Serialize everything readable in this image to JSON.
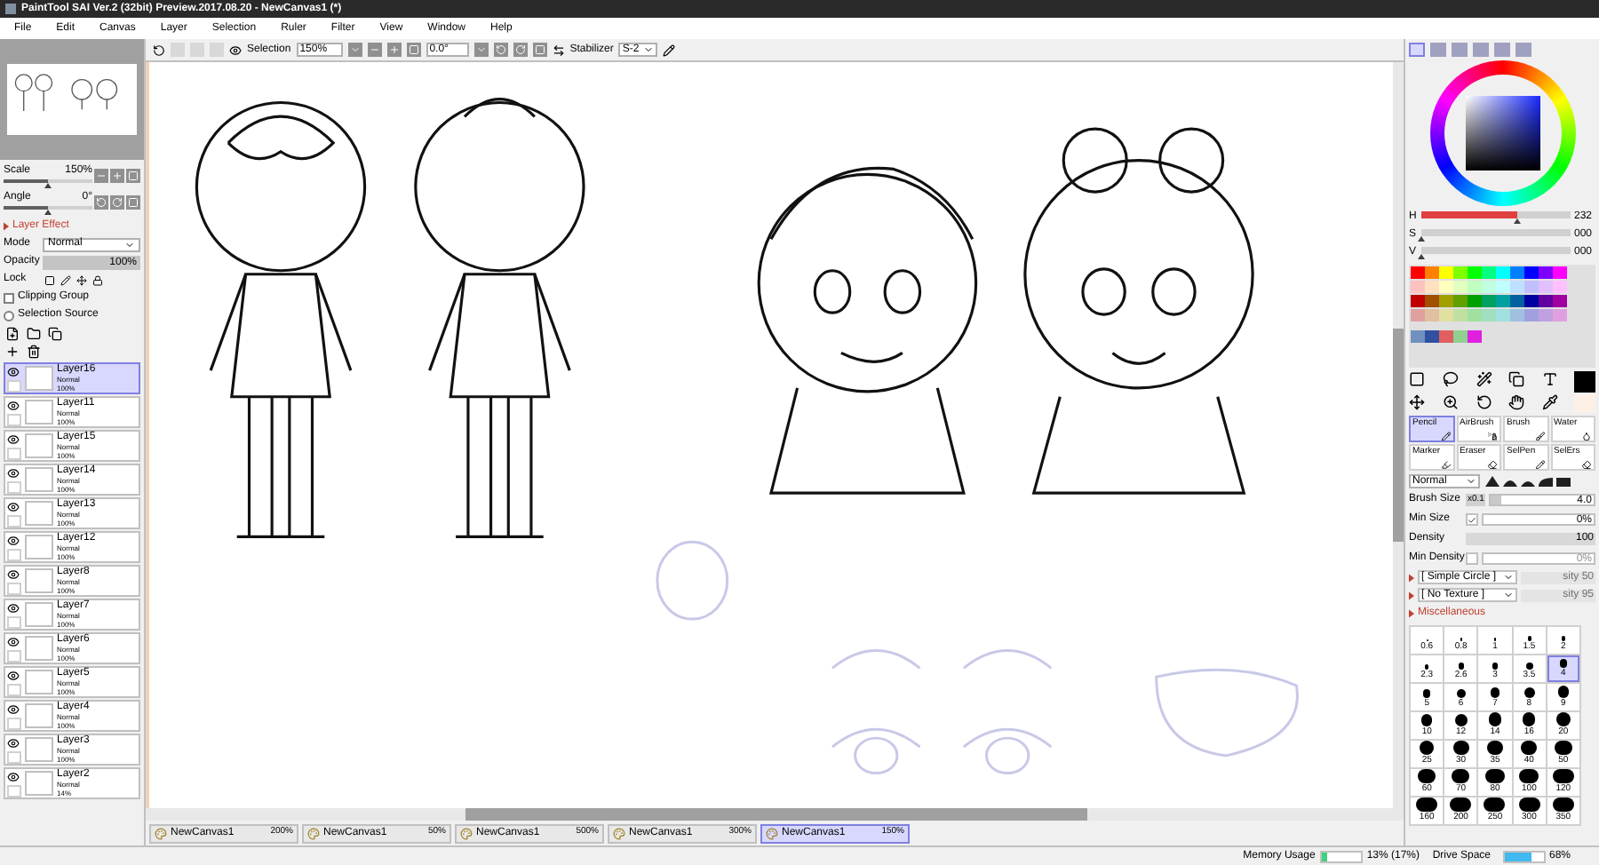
{
  "window": {
    "title": "PaintTool SAI Ver.2 (32bit) Preview.2017.08.20 - NewCanvas1 (*)"
  },
  "menu": [
    "File",
    "Edit",
    "Canvas",
    "Layer",
    "Selection",
    "Ruler",
    "Filter",
    "View",
    "Window",
    "Help"
  ],
  "navigator": {
    "sliders": [
      {
        "label": "Scale",
        "value": "150%",
        "level": 0.5
      },
      {
        "label": "Angle",
        "value": "0°",
        "level": 0.5
      }
    ]
  },
  "layer_panel": {
    "section": "Layer Effect",
    "mode_label": "Mode",
    "mode": "Normal",
    "opacity_label": "Opacity",
    "opacity": {
      "value": "100%",
      "level": 1
    },
    "lock_label": "Lock",
    "options": [
      {
        "label": "Clipping Group",
        "checked": false,
        "kind": "checkbox"
      },
      {
        "label": "Selection Source",
        "checked": false,
        "kind": "radio"
      }
    ]
  },
  "layers": [
    {
      "name": "Layer16",
      "mode": "Normal",
      "opacity": "100%",
      "selected": true,
      "visible": true
    },
    {
      "name": "Layer11",
      "mode": "Normal",
      "opacity": "100%",
      "selected": false,
      "visible": true
    },
    {
      "name": "Layer15",
      "mode": "Normal",
      "opacity": "100%",
      "selected": false,
      "visible": true
    },
    {
      "name": "Layer14",
      "mode": "Normal",
      "opacity": "100%",
      "selected": false,
      "visible": true
    },
    {
      "name": "Layer13",
      "mode": "Normal",
      "opacity": "100%",
      "selected": false,
      "visible": true
    },
    {
      "name": "Layer12",
      "mode": "Normal",
      "opacity": "100%",
      "selected": false,
      "visible": true
    },
    {
      "name": "Layer8",
      "mode": "Normal",
      "opacity": "100%",
      "selected": false,
      "visible": true
    },
    {
      "name": "Layer7",
      "mode": "Normal",
      "opacity": "100%",
      "selected": false,
      "visible": true
    },
    {
      "name": "Layer6",
      "mode": "Normal",
      "opacity": "100%",
      "selected": false,
      "visible": true
    },
    {
      "name": "Layer5",
      "mode": "Normal",
      "opacity": "100%",
      "selected": false,
      "visible": true
    },
    {
      "name": "Layer4",
      "mode": "Normal",
      "opacity": "100%",
      "selected": false,
      "visible": true
    },
    {
      "name": "Layer3",
      "mode": "Normal",
      "opacity": "100%",
      "selected": false,
      "visible": true
    },
    {
      "name": "Layer2",
      "mode": "Normal",
      "opacity": "14%",
      "selected": false,
      "visible": true
    }
  ],
  "toolbar": {
    "selection_label": "Selection",
    "selection_visible": true,
    "zoom": "150%",
    "angle": "0.0°",
    "stabilizer_label": "Stabilizer",
    "stabilizer": "S-2"
  },
  "canvas_tabs": [
    {
      "name": "NewCanvas1",
      "zoom": "200%",
      "selected": false
    },
    {
      "name": "NewCanvas1",
      "zoom": "50%",
      "selected": false
    },
    {
      "name": "NewCanvas1",
      "zoom": "500%",
      "selected": false
    },
    {
      "name": "NewCanvas1",
      "zoom": "300%",
      "selected": false
    },
    {
      "name": "NewCanvas1",
      "zoom": "150%",
      "selected": true
    }
  ],
  "status": {
    "memory": {
      "label": "Memory Usage",
      "value": "13% (17%)",
      "level": 0.13
    },
    "drive": {
      "label": "Drive Space",
      "value": "68%",
      "level": 0.68
    }
  },
  "color": {
    "hsv": [
      {
        "label": "H",
        "value": "232",
        "level": 0.64
      },
      {
        "label": "S",
        "value": "000",
        "level": 0
      },
      {
        "label": "V",
        "value": "000",
        "level": 0
      }
    ],
    "palette": [
      [
        {
          "color": "#ff0000"
        },
        {
          "color": "#ff8000"
        },
        {
          "color": "#ffff00"
        },
        {
          "color": "#80ff00"
        },
        {
          "color": "#00ff00"
        },
        {
          "color": "#00ff80"
        },
        {
          "color": "#00ffff"
        },
        {
          "color": "#0080ff"
        },
        {
          "color": "#0000ff"
        },
        {
          "color": "#8000ff"
        },
        {
          "color": "#ff00ff"
        }
      ],
      [
        {
          "color": "#ffc0c0"
        },
        {
          "color": "#ffe0c0"
        },
        {
          "color": "#ffffc0"
        },
        {
          "color": "#e0ffc0"
        },
        {
          "color": "#c0ffc0"
        },
        {
          "color": "#c0ffe0"
        },
        {
          "color": "#c0ffff"
        },
        {
          "color": "#c0e0ff"
        },
        {
          "color": "#c0c0ff"
        },
        {
          "color": "#e0c0ff"
        },
        {
          "color": "#ffc0ff"
        }
      ],
      [
        {
          "color": "#c00000"
        },
        {
          "color": "#a05000"
        },
        {
          "color": "#a0a000"
        },
        {
          "color": "#60a000"
        },
        {
          "color": "#00a000"
        },
        {
          "color": "#00a060"
        },
        {
          "color": "#00a0a0"
        },
        {
          "color": "#0060a0"
        },
        {
          "color": "#0000a0"
        },
        {
          "color": "#6000a0"
        },
        {
          "color": "#a000a0"
        }
      ],
      [
        {
          "color": "#e0a0a0"
        },
        {
          "color": "#e0c0a0"
        },
        {
          "color": "#e0e0a0"
        },
        {
          "color": "#c0e0a0"
        },
        {
          "color": "#a0e0a0"
        },
        {
          "color": "#a0e0c0"
        },
        {
          "color": "#a0e0e0"
        },
        {
          "color": "#a0c0e0"
        },
        {
          "color": "#a0a0e0"
        },
        {
          "color": "#c0a0e0"
        },
        {
          "color": "#e0a0e0"
        }
      ],
      [
        {
          "color": "#7090c0"
        },
        {
          "color": "#3050a0"
        },
        {
          "color": "#e06060"
        },
        {
          "color": "#90d090"
        },
        {
          "color": "#e020e0"
        }
      ]
    ]
  },
  "brush_tools": [
    {
      "label": "Pencil",
      "selected": true
    },
    {
      "label": "AirBrush",
      "selected": false
    },
    {
      "label": "Brush",
      "selected": false
    },
    {
      "label": "Water",
      "selected": false
    },
    {
      "label": "Marker",
      "selected": false
    },
    {
      "label": "Eraser",
      "selected": false
    },
    {
      "label": "SelPen",
      "selected": false
    },
    {
      "label": "SelErs",
      "selected": false
    }
  ],
  "brush": {
    "mode": "Normal",
    "size_label": "Brush Size",
    "multiplier": "x0.1",
    "size": {
      "value": "4.0",
      "level": 0.1
    },
    "min_size_label": "Min Size",
    "min_size_checked": true,
    "min_size": "0%",
    "density_label": "Density",
    "density": {
      "value": "100",
      "level": 1
    },
    "min_density_label": "Min Density",
    "min_density_checked": false,
    "min_density": "0%",
    "shape": "[ Simple Circle ]",
    "shape_intensity": "sity 50",
    "texture": "[ No Texture ]",
    "texture_intensity": "sity 95",
    "misc": "Miscellaneous",
    "sizes": [
      {
        "label": "0.6",
        "selected": false
      },
      {
        "label": "0.8",
        "selected": false
      },
      {
        "label": "1",
        "selected": false
      },
      {
        "label": "1.5",
        "selected": false
      },
      {
        "label": "2",
        "selected": false
      },
      {
        "label": "2.3",
        "selected": false
      },
      {
        "label": "2.6",
        "selected": false
      },
      {
        "label": "3",
        "selected": false
      },
      {
        "label": "3.5",
        "selected": false
      },
      {
        "label": "4",
        "selected": true
      },
      {
        "label": "5",
        "selected": false
      },
      {
        "label": "6",
        "selected": false
      },
      {
        "label": "7",
        "selected": false
      },
      {
        "label": "8",
        "selected": false
      },
      {
        "label": "9",
        "selected": false
      },
      {
        "label": "10",
        "selected": false
      },
      {
        "label": "12",
        "selected": false
      },
      {
        "label": "14",
        "selected": false
      },
      {
        "label": "16",
        "selected": false
      },
      {
        "label": "20",
        "selected": false
      },
      {
        "label": "25",
        "selected": false
      },
      {
        "label": "30",
        "selected": false
      },
      {
        "label": "35",
        "selected": false
      },
      {
        "label": "40",
        "selected": false
      },
      {
        "label": "50",
        "selected": false
      },
      {
        "label": "60",
        "selected": false
      },
      {
        "label": "70",
        "selected": false
      },
      {
        "label": "80",
        "selected": false
      },
      {
        "label": "100",
        "selected": false
      },
      {
        "label": "120",
        "selected": false
      },
      {
        "label": "160",
        "selected": false
      },
      {
        "label": "200",
        "selected": false
      },
      {
        "label": "250",
        "selected": false
      },
      {
        "label": "300",
        "selected": false
      },
      {
        "label": "350",
        "selected": false
      }
    ]
  }
}
